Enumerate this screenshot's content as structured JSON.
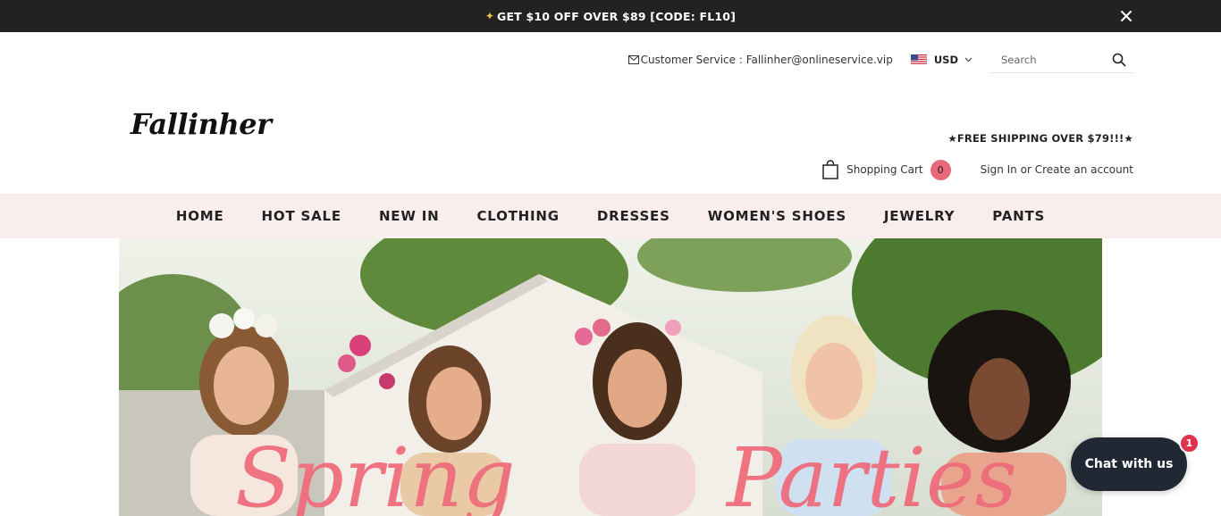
{
  "announcement": {
    "text": "GET $10 OFF OVER $89 [CODE: FL10]"
  },
  "header": {
    "customer_service": "Customer Service : Fallinher@onlineservice.vip",
    "currency": "USD",
    "search_placeholder": "Search",
    "logo": "Fallinher",
    "free_shipping": "★FREE SHIPPING OVER $79!!!★",
    "cart_label": "Shopping Cart",
    "cart_count": "0",
    "sign_in": "Sign In",
    "or": "or",
    "create_account": "Create an account"
  },
  "nav": {
    "items": [
      "HOME",
      "HOT SALE",
      "NEW IN",
      "CLOTHING",
      "DRESSES",
      "WOMEN'S SHOES",
      "JEWELRY",
      "PANTS"
    ]
  },
  "hero": {
    "script_left": "Spring",
    "script_right": "Parties"
  },
  "chat": {
    "label": "Chat with us",
    "badge": "1"
  }
}
